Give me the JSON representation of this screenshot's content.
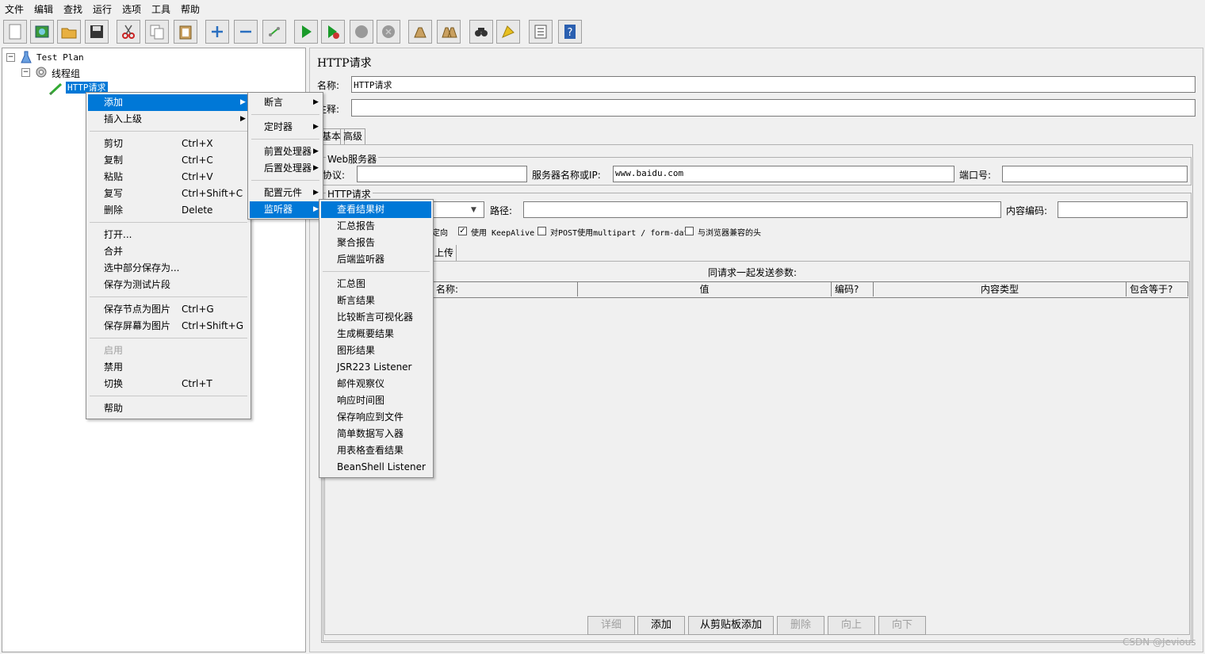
{
  "menubar": [
    "文件",
    "编辑",
    "查找",
    "运行",
    "选项",
    "工具",
    "帮助"
  ],
  "toolbar_icons": [
    "new-icon",
    "templates-icon",
    "open-icon",
    "save-icon",
    "cut-icon",
    "copy-icon",
    "paste-icon",
    "expand-icon",
    "collapse-icon",
    "toggle-icon",
    "start-icon",
    "start-no-pause-icon",
    "stop-icon",
    "shutdown-icon",
    "clear-icon",
    "clear-all-icon",
    "search-icon",
    "reset-search-icon",
    "function-helper-icon",
    "help-icon"
  ],
  "tree": {
    "test_plan": "Test Plan",
    "thread_group": "线程组",
    "http_request": "HTTP请求"
  },
  "context_menu": {
    "add": "添加",
    "insert_parent": "插入上级",
    "cut": "剪切",
    "cut_sc": "Ctrl+X",
    "copy": "复制",
    "copy_sc": "Ctrl+C",
    "paste": "粘贴",
    "paste_sc": "Ctrl+V",
    "duplicate": "复写",
    "duplicate_sc": "Ctrl+Shift+C",
    "delete": "删除",
    "delete_sc": "Delete",
    "open": "打开...",
    "merge": "合并",
    "save_selection": "选中部分保存为...",
    "save_fragment": "保存为测试片段",
    "save_node_image": "保存节点为图片",
    "save_node_image_sc": "Ctrl+G",
    "save_screen_image": "保存屏幕为图片",
    "save_screen_image_sc": "Ctrl+Shift+G",
    "enable": "启用",
    "disable": "禁用",
    "toggle": "切换",
    "toggle_sc": "Ctrl+T",
    "help": "帮助"
  },
  "add_submenu": {
    "assertion": "断言",
    "timer": "定时器",
    "pre_processor": "前置处理器",
    "post_processor": "后置处理器",
    "config_element": "配置元件",
    "listener": "监听器"
  },
  "listener_submenu": [
    "查看结果树",
    "汇总报告",
    "聚合报告",
    "后端监听器",
    "汇总图",
    "断言结果",
    "比较断言可视化器",
    "生成概要结果",
    "图形结果",
    "JSR223 Listener",
    "邮件观察仪",
    "响应时间图",
    "保存响应到文件",
    "简单数据写入器",
    "用表格查看结果",
    "BeanShell Listener"
  ],
  "panel": {
    "title": "HTTP请求",
    "name_label": "名称:",
    "name_value": "HTTP请求",
    "comment_label": "注释:",
    "tab_basic": "基本",
    "tab_advanced": "高级",
    "web_server_group": "Web服务器",
    "protocol_label": "协议:",
    "server_label": "服务器名称或IP:",
    "server_value": "www.baidu.com",
    "port_label": "端口号:",
    "http_group": "HTTP请求",
    "path_label": "路径:",
    "encoding_label": "内容编码:",
    "redirect_fragment": "定向",
    "keepalive_label": "使用 KeepAlive",
    "keepalive_checked": true,
    "multipart_label": "对POST使用multipart / form-data",
    "browser_headers_label": "与浏览器兼容的头",
    "upload_tab_fragment": "上传",
    "params_title": "同请求一起发送参数:",
    "col_name": "名称:",
    "col_value": "值",
    "col_encode": "编码?",
    "col_content_type": "内容类型",
    "col_include_equals": "包含等于?",
    "btn_detail": "详细",
    "btn_add": "添加",
    "btn_add_clipboard": "从剪贴板添加",
    "btn_delete": "删除",
    "btn_up": "向上",
    "btn_down": "向下"
  },
  "watermark": "CSDN @Jevious"
}
